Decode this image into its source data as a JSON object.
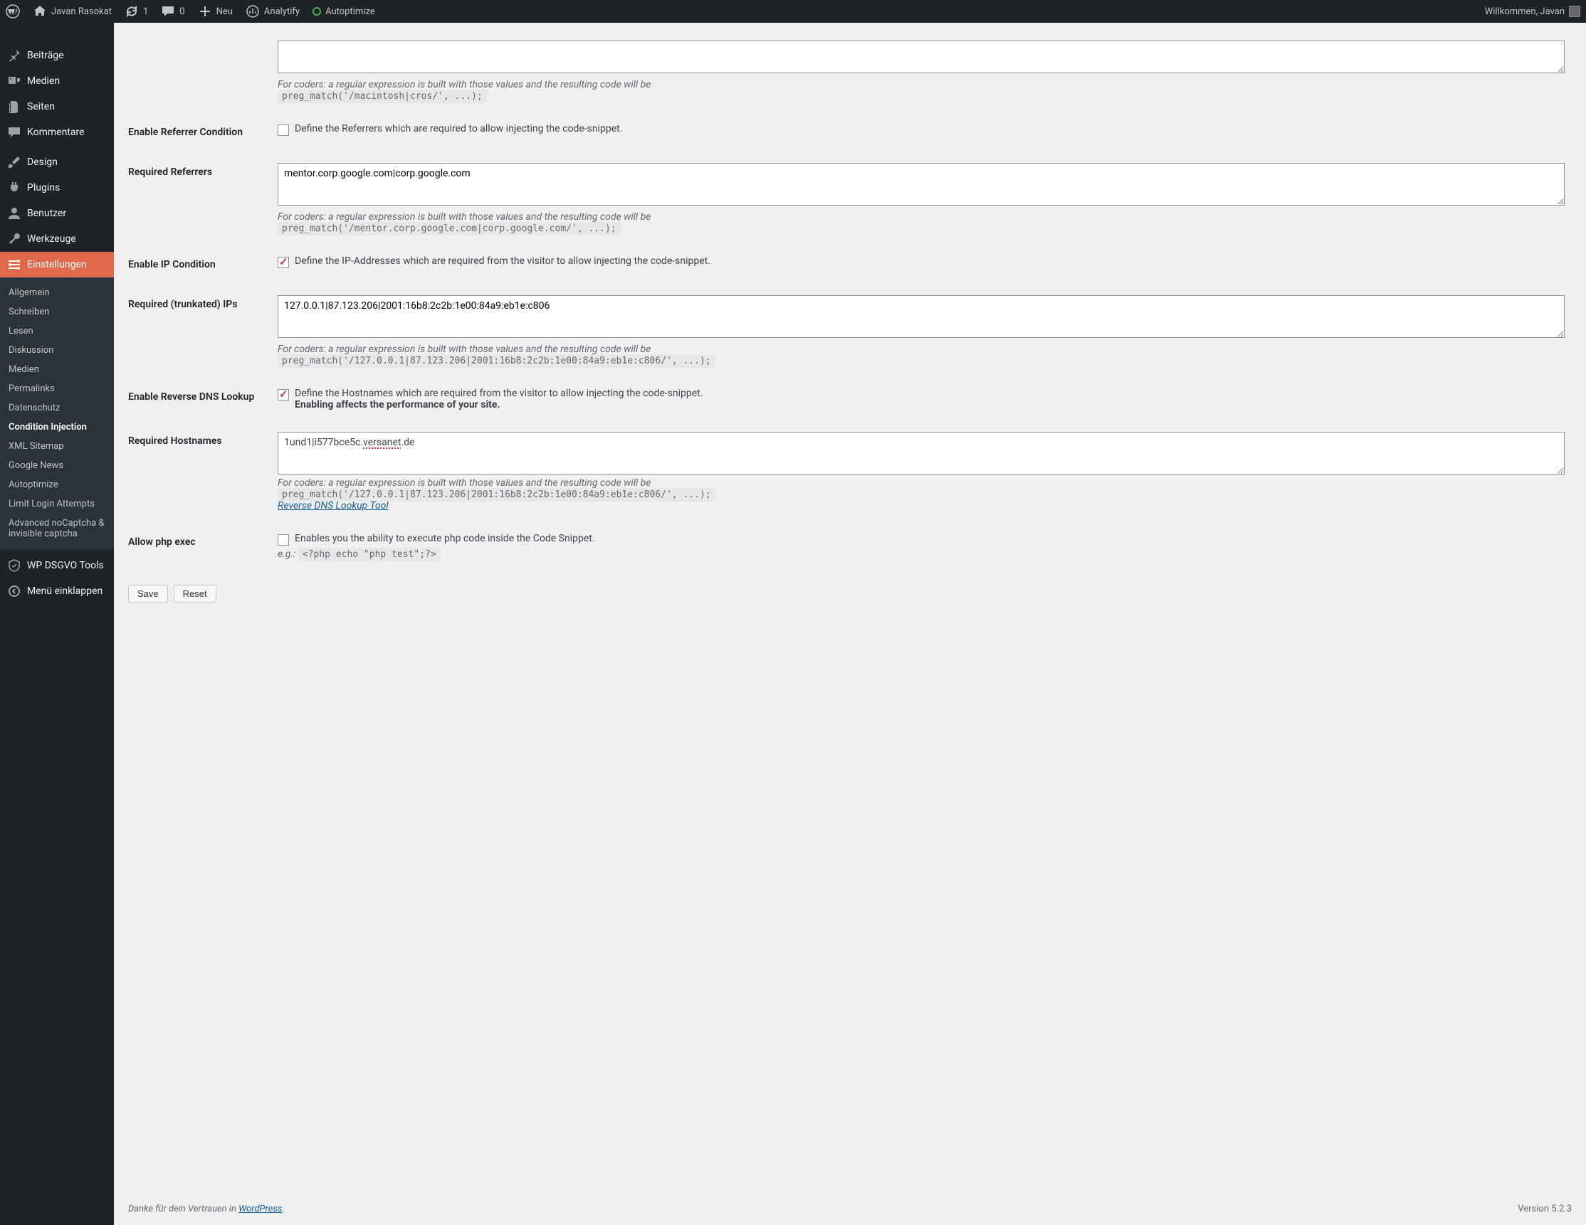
{
  "adminbar": {
    "site_name": "Javan Rasokat",
    "updates": "1",
    "comments": "0",
    "new_label": "Neu",
    "analytify": "Analytify",
    "autoptimize": "Autoptimize",
    "welcome": "Willkommen, Javan"
  },
  "sidebar": {
    "items": [
      {
        "label": "Beiträge",
        "icon": "pin"
      },
      {
        "label": "Medien",
        "icon": "media"
      },
      {
        "label": "Seiten",
        "icon": "pages"
      },
      {
        "label": "Kommentare",
        "icon": "comment"
      }
    ],
    "items2": [
      {
        "label": "Design",
        "icon": "brush"
      },
      {
        "label": "Plugins",
        "icon": "plug"
      },
      {
        "label": "Benutzer",
        "icon": "user"
      },
      {
        "label": "Werkzeuge",
        "icon": "wrench"
      },
      {
        "label": "Einstellungen",
        "icon": "settings",
        "current": true
      }
    ],
    "submenu": [
      "Allgemein",
      "Schreiben",
      "Lesen",
      "Diskussion",
      "Medien",
      "Permalinks",
      "Datenschutz",
      "Condition Injection",
      "XML Sitemap",
      "Google News",
      "Autoptimize",
      "Limit Login Attempts",
      "Advanced noCaptcha & invisible captcha"
    ],
    "submenu_current": "Condition Injection",
    "dsgvo": "WP DSGVO Tools",
    "collapse": "Menü einklappen"
  },
  "form": {
    "coders_hint": "For coders: a regular expression is built with those values and the resulting code will be",
    "row0": {
      "code": "preg_match('/macintosh|cros/', ...);"
    },
    "row_referrer": {
      "th": "Enable Referrer Condition",
      "chk_label": "Define the Referrers which are required to allow injecting the code-snippet.",
      "checked": false
    },
    "row_referrers": {
      "th": "Required Referrers",
      "value": "mentor.corp.google.com|corp.google.com",
      "code": "preg_match('/mentor.corp.google.com|corp.google.com/', ...);"
    },
    "row_ip": {
      "th": "Enable IP Condition",
      "chk_label": "Define the IP-Addresses which are required from the visitor to allow injecting the code-snippet.",
      "checked": true
    },
    "row_ips": {
      "th": "Required (trunkated) IPs",
      "value": "127.0.0.1|87.123.206|2001:16b8:2c2b:1e00:84a9:eb1e:c806",
      "code": "preg_match('/127.0.0.1|87.123.206|2001:16b8:2c2b:1e00:84a9:eb1e:c806/', ...);"
    },
    "row_dns": {
      "th": "Enable Reverse DNS Lookup",
      "chk_label": "Define the Hostnames which are required from the visitor to allow injecting the code-snippet.",
      "bold": "Enabling affects the performance of your site.",
      "checked": true
    },
    "row_hosts": {
      "th": "Required Hostnames",
      "value_pre": "1und1|i577bce5c.",
      "value_spell": "versanet",
      "value_post": ".de",
      "code": "preg_match('/127.0.0.1|87.123.206|2001:16b8:2c2b:1e00:84a9:eb1e:c806/', ...);",
      "link": "Reverse DNS Lookup Tool"
    },
    "row_php": {
      "th": "Allow php exec",
      "chk_label": "Enables you the ability to execute php code inside the Code Snippet.",
      "eg_label": "e.g.:",
      "eg_code": "<?php echo \"php test\";?>",
      "checked": false
    },
    "save": "Save",
    "reset": "Reset"
  },
  "footer": {
    "thanks_pre": "Danke für dein Vertrauen in ",
    "wp": "WordPress",
    "version": "Version 5.2.3"
  }
}
